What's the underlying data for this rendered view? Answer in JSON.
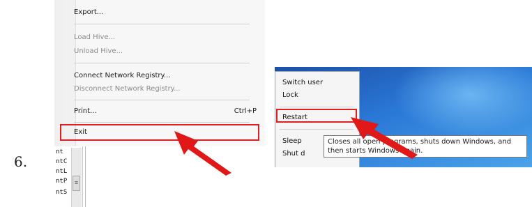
{
  "step": {
    "number": "6."
  },
  "regedit_menu": {
    "items": [
      {
        "label": "Export...",
        "enabled": true
      },
      {
        "label": "Load Hive...",
        "enabled": false
      },
      {
        "label": "Unload Hive...",
        "enabled": false
      },
      {
        "label": "Connect Network Registry...",
        "enabled": true
      },
      {
        "label": "Disconnect Network Registry...",
        "enabled": false
      },
      {
        "label": "Print...",
        "enabled": true,
        "shortcut": "Ctrl+P"
      },
      {
        "label": "Exit",
        "enabled": true,
        "highlighted": true
      }
    ],
    "tree_fragments": [
      "nt",
      "ntC",
      "ntL",
      "ntP",
      "ntS"
    ]
  },
  "shutdown_menu": {
    "items": [
      {
        "label": "Switch user"
      },
      {
        "label": "Lock"
      },
      {
        "label": "Restart",
        "highlighted": true
      },
      {
        "label": "Sleep"
      },
      {
        "label": "Shut d"
      }
    ],
    "tooltip": {
      "line1": "Closes all open programs, shuts down Windows, and",
      "line2": "then starts Windows again."
    }
  },
  "colors": {
    "highlight_border": "#e02020",
    "arrow": "#e01818",
    "desktop_blue": "#2a78d6"
  }
}
